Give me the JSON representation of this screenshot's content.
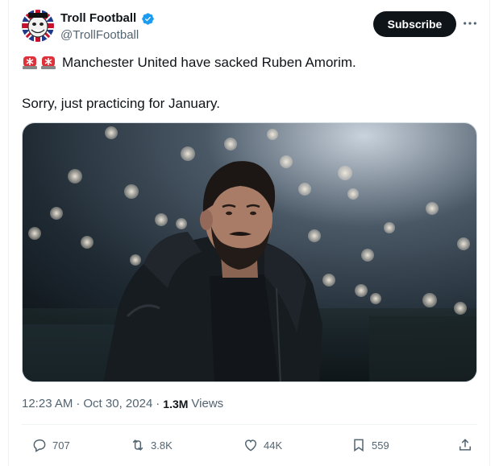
{
  "tweet": {
    "author_name": "Troll Football",
    "author_handle": "@TrollFootball",
    "subscribe_label": "Subscribe",
    "line1": "Manchester United have sacked Ruben Amorim.",
    "line2": "Sorry, just practicing for January.",
    "time": "12:23 AM",
    "date": "Oct 30, 2024",
    "views_count": "1.3M",
    "views_label": "Views",
    "separator": "·"
  },
  "actions": {
    "replies": "707",
    "reposts": "3.8K",
    "likes": "44K",
    "bookmarks": "559"
  },
  "icons": {
    "verified": "verified-badge-icon",
    "siren": "police-siren-icon",
    "more": "more-options-icon",
    "reply": "reply-icon",
    "repost": "repost-icon",
    "like": "heart-icon",
    "bookmark": "bookmark-icon",
    "share": "share-icon"
  },
  "colors": {
    "verified_blue": "#1d9bf0",
    "text_primary": "#0f1419",
    "text_secondary": "#536471",
    "subscribe_bg": "#0f1419"
  }
}
